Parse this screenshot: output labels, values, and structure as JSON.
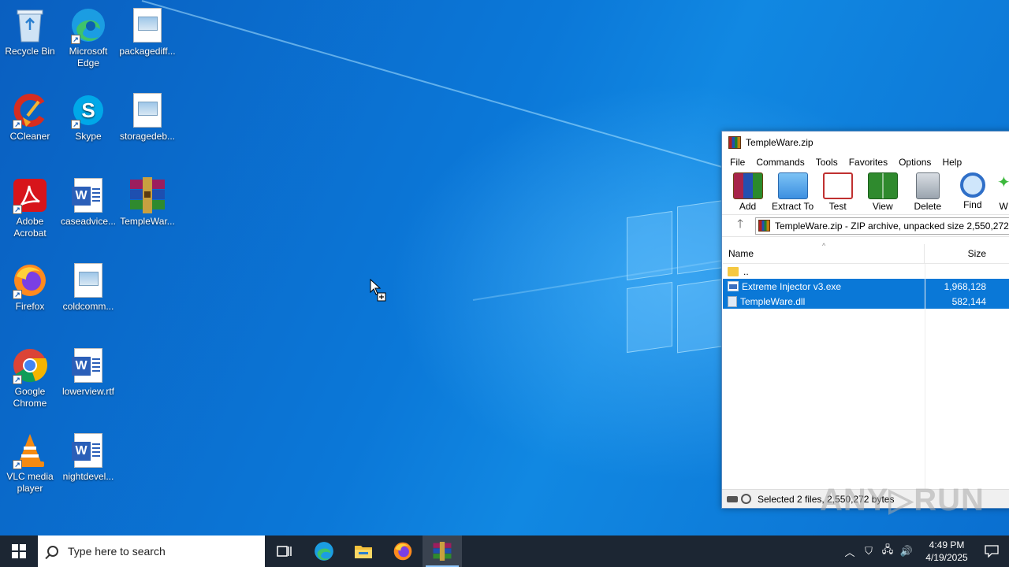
{
  "desktop": {
    "icons": [
      {
        "label": "Recycle Bin",
        "icon": "recycle-bin-icon"
      },
      {
        "label": "Microsoft Edge",
        "icon": "edge-icon"
      },
      {
        "label": "packagediff...",
        "icon": "image-file-icon"
      },
      {
        "label": "CCleaner",
        "icon": "ccleaner-icon"
      },
      {
        "label": "Skype",
        "icon": "skype-icon"
      },
      {
        "label": "storagedeb...",
        "icon": "image-file-icon"
      },
      {
        "label": "Adobe Acrobat",
        "icon": "acrobat-icon"
      },
      {
        "label": "caseadvice...",
        "icon": "word-doc-icon"
      },
      {
        "label": "TempleWar...",
        "icon": "winrar-archive-icon"
      },
      {
        "label": "Firefox",
        "icon": "firefox-icon"
      },
      {
        "label": "coldcomm...",
        "icon": "image-file-icon"
      },
      {
        "label": "Google Chrome",
        "icon": "chrome-icon"
      },
      {
        "label": "lowerview.rtf",
        "icon": "word-doc-icon"
      },
      {
        "label": "VLC media player",
        "icon": "vlc-icon"
      },
      {
        "label": "nightdevel...",
        "icon": "word-doc-icon"
      }
    ]
  },
  "winrar": {
    "title": "TempleWare.zip",
    "menu": [
      "File",
      "Commands",
      "Tools",
      "Favorites",
      "Options",
      "Help"
    ],
    "toolbar": [
      "Add",
      "Extract To",
      "Test",
      "View",
      "Delete",
      "Find",
      "W"
    ],
    "path": "TempleWare.zip - ZIP archive, unpacked size 2,550,272",
    "columns": {
      "name": "Name",
      "size": "Size"
    },
    "rows": [
      {
        "name": "..",
        "size": "",
        "selected": false,
        "icon": "folder-icon"
      },
      {
        "name": "Extreme Injector v3.exe",
        "size": "1,968,128",
        "selected": true,
        "icon": "exe-icon"
      },
      {
        "name": "TempleWare.dll",
        "size": "582,144",
        "selected": true,
        "icon": "dll-icon"
      }
    ],
    "status": "Selected 2 files, 2,550,272 bytes"
  },
  "watermark": "ANY▷RUN",
  "taskbar": {
    "search_placeholder": "Type here to search",
    "time": "4:49 PM",
    "date": "4/19/2025"
  },
  "colors": {
    "selection": "#0a78d7",
    "taskbar": "#1c2633"
  }
}
